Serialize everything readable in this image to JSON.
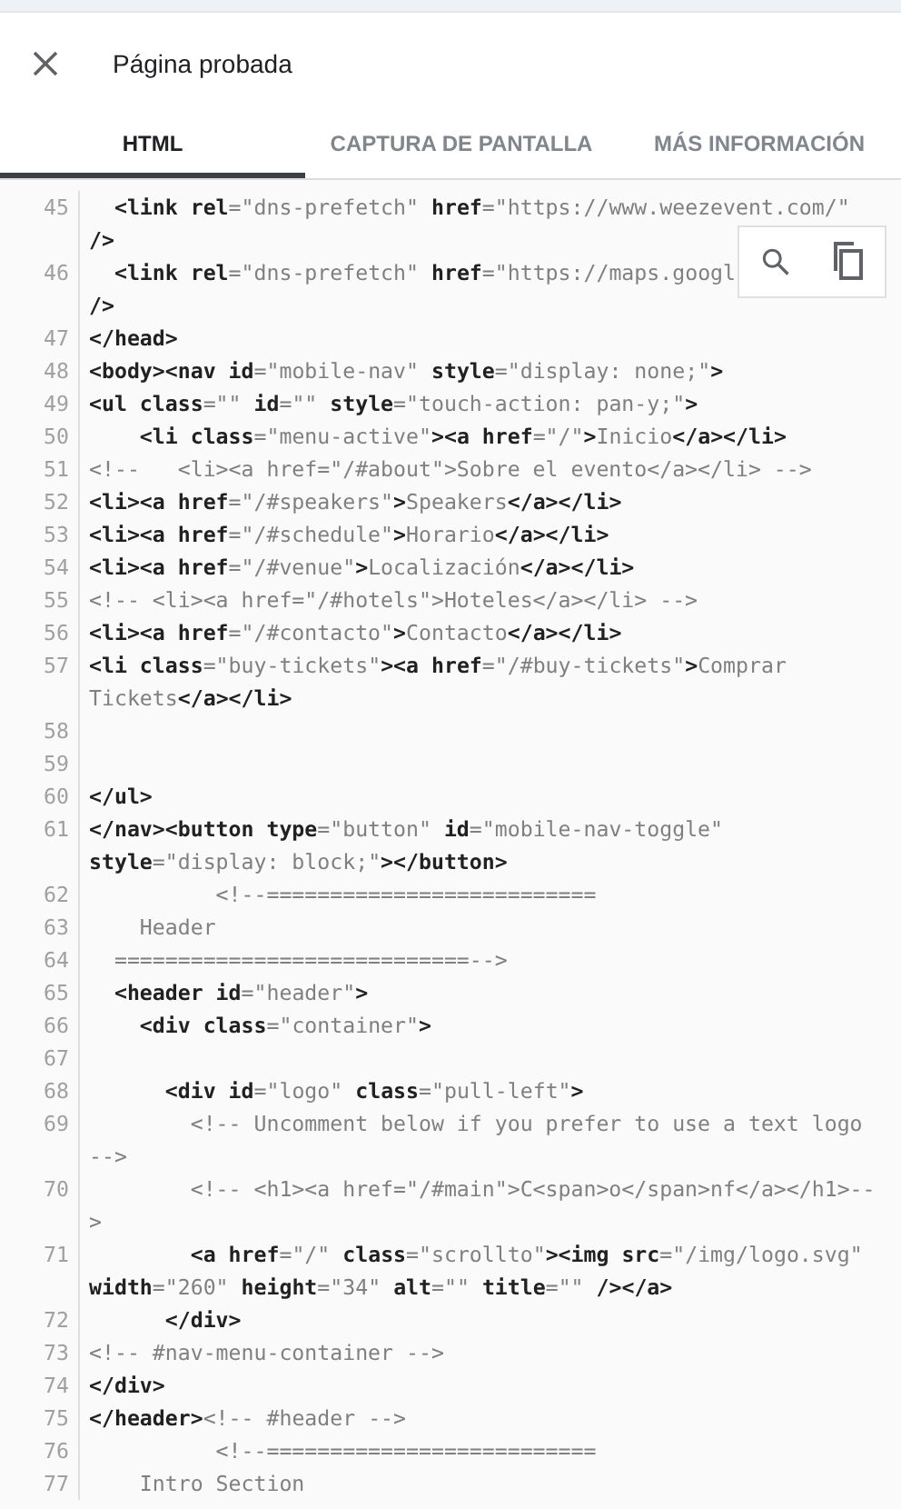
{
  "dialog": {
    "title": "Página probada"
  },
  "tabs": [
    {
      "label": "HTML",
      "selected": true
    },
    {
      "label": "CAPTURA DE PANTALLA",
      "selected": false
    },
    {
      "label": "MÁS INFORMACIÓN",
      "selected": false
    }
  ],
  "code_lines": [
    {
      "number": "45",
      "rows": [
        "  **<link rel**=\"dns-prefetch\" **href**=\"https://www.weezevent.com/\"",
        "**/>**"
      ]
    },
    {
      "number": "46",
      "rows": [
        "  **<link rel**=\"dns-prefetch\" **href**=\"https://maps.googl",
        "**/>**"
      ]
    },
    {
      "number": "47",
      "rows": [
        "**</head>**"
      ]
    },
    {
      "number": "48",
      "rows": [
        "**<body><nav id**=\"mobile-nav\" **style**=\"display: none;\"**>**"
      ]
    },
    {
      "number": "49",
      "rows": [
        "**<ul class**=\"\" **id**=\"\" **style**=\"touch-action: pan-y;\"**>**"
      ]
    },
    {
      "number": "50",
      "rows": [
        "    **<li class**=\"menu-active\"**><a href**=\"/\"**>**Inicio**</a></li>**"
      ]
    },
    {
      "number": "51",
      "rows": [
        "<!--   <li><a href=\"/#about\">Sobre el evento</a></li> -->"
      ]
    },
    {
      "number": "52",
      "rows": [
        "**<li><a href**=\"/#speakers\"**>**Speakers**</a></li>**"
      ]
    },
    {
      "number": "53",
      "rows": [
        "**<li><a href**=\"/#schedule\"**>**Horario**</a></li>**"
      ]
    },
    {
      "number": "54",
      "rows": [
        "**<li><a href**=\"/#venue\"**>**Localización**</a></li>**"
      ]
    },
    {
      "number": "55",
      "rows": [
        "<!-- <li><a href=\"/#hotels\">Hoteles</a></li> -->"
      ]
    },
    {
      "number": "56",
      "rows": [
        "**<li><a href**=\"/#contacto\"**>**Contacto**</a></li>**"
      ]
    },
    {
      "number": "57",
      "rows": [
        "**<li class**=\"buy-tickets\"**><a href**=\"/#buy-tickets\"**>**Comprar",
        "Tickets**</a></li>**"
      ]
    },
    {
      "number": "58"
    },
    {
      "number": "59"
    },
    {
      "number": "60",
      "rows": [
        "**</ul>**"
      ]
    },
    {
      "number": "61",
      "rows": [
        "**</nav><button type**=\"button\" **id**=\"mobile-nav-toggle\"",
        "**style**=\"display: block;\"**></button>**"
      ]
    },
    {
      "number": "62",
      "rows": [
        "          <!--=========================="
      ]
    },
    {
      "number": "63",
      "rows": [
        "    Header"
      ]
    },
    {
      "number": "64",
      "rows": [
        "  ============================-->"
      ]
    },
    {
      "number": "65",
      "rows": [
        "  **<header id**=\"header\"**>**"
      ]
    },
    {
      "number": "66",
      "rows": [
        "    **<div class**=\"container\"**>**"
      ]
    },
    {
      "number": "67"
    },
    {
      "number": "68",
      "rows": [
        "      **<div id**=\"logo\" **class**=\"pull-left\"**>**"
      ]
    },
    {
      "number": "69",
      "rows": [
        "        <!-- Uncomment below if you prefer to use a text logo",
        "-->"
      ]
    },
    {
      "number": "70",
      "rows": [
        "        <!-- <h1><a href=\"/#main\">C<span>o</span>nf</a></h1>--",
        ">"
      ]
    },
    {
      "number": "71",
      "rows": [
        "        **<a href**=\"/\" **class**=\"scrollto\"**><img src**=\"/img/logo.svg\"",
        "**width**=\"260\" **height**=\"34\" **alt**=\"\" **title**=\"\" **/></a>**"
      ]
    },
    {
      "number": "72",
      "rows": [
        "      **</div>**"
      ]
    },
    {
      "number": "73",
      "rows": [
        "<!-- #nav-menu-container -->"
      ]
    },
    {
      "number": "74",
      "rows": [
        "**</div>**"
      ]
    },
    {
      "number": "75",
      "rows": [
        "**</header>**<!-- #header -->"
      ]
    },
    {
      "number": "76",
      "rows": [
        "          <!--=========================="
      ]
    },
    {
      "number": "77",
      "rows": [
        "    Intro Section"
      ]
    }
  ]
}
